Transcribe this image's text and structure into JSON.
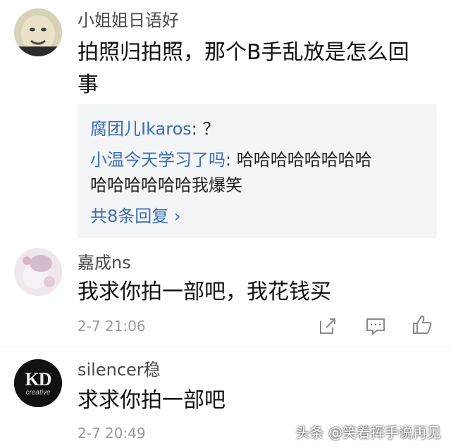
{
  "comments": [
    {
      "username": "小姐姐日语好",
      "content": "拍照归拍照，那个B手乱放是怎么回事",
      "replies": [
        {
          "author": "腐团儿Ikaros",
          "sep": ":",
          "text": " ？"
        },
        {
          "author": "小温今天学习了吗",
          "sep": ":",
          "text": " 哈哈哈哈哈哈哈哈",
          "text_cont": "哈哈哈哈哈哈我爆笑"
        }
      ],
      "more_replies": "共8条回复 ›"
    },
    {
      "username": "嘉成ns",
      "content": "我求你拍一部吧，我花钱买",
      "time": "2-7 21:06"
    },
    {
      "username": "silencer稳",
      "content": "求求你拍一部吧",
      "time": "2-7 20:49",
      "avatar_text": "KD",
      "avatar_subtext": "creative"
    }
  ],
  "watermark": "头条 @笑着挥手说再见",
  "icons": [
    "share-icon",
    "comment-icon",
    "like-icon"
  ]
}
